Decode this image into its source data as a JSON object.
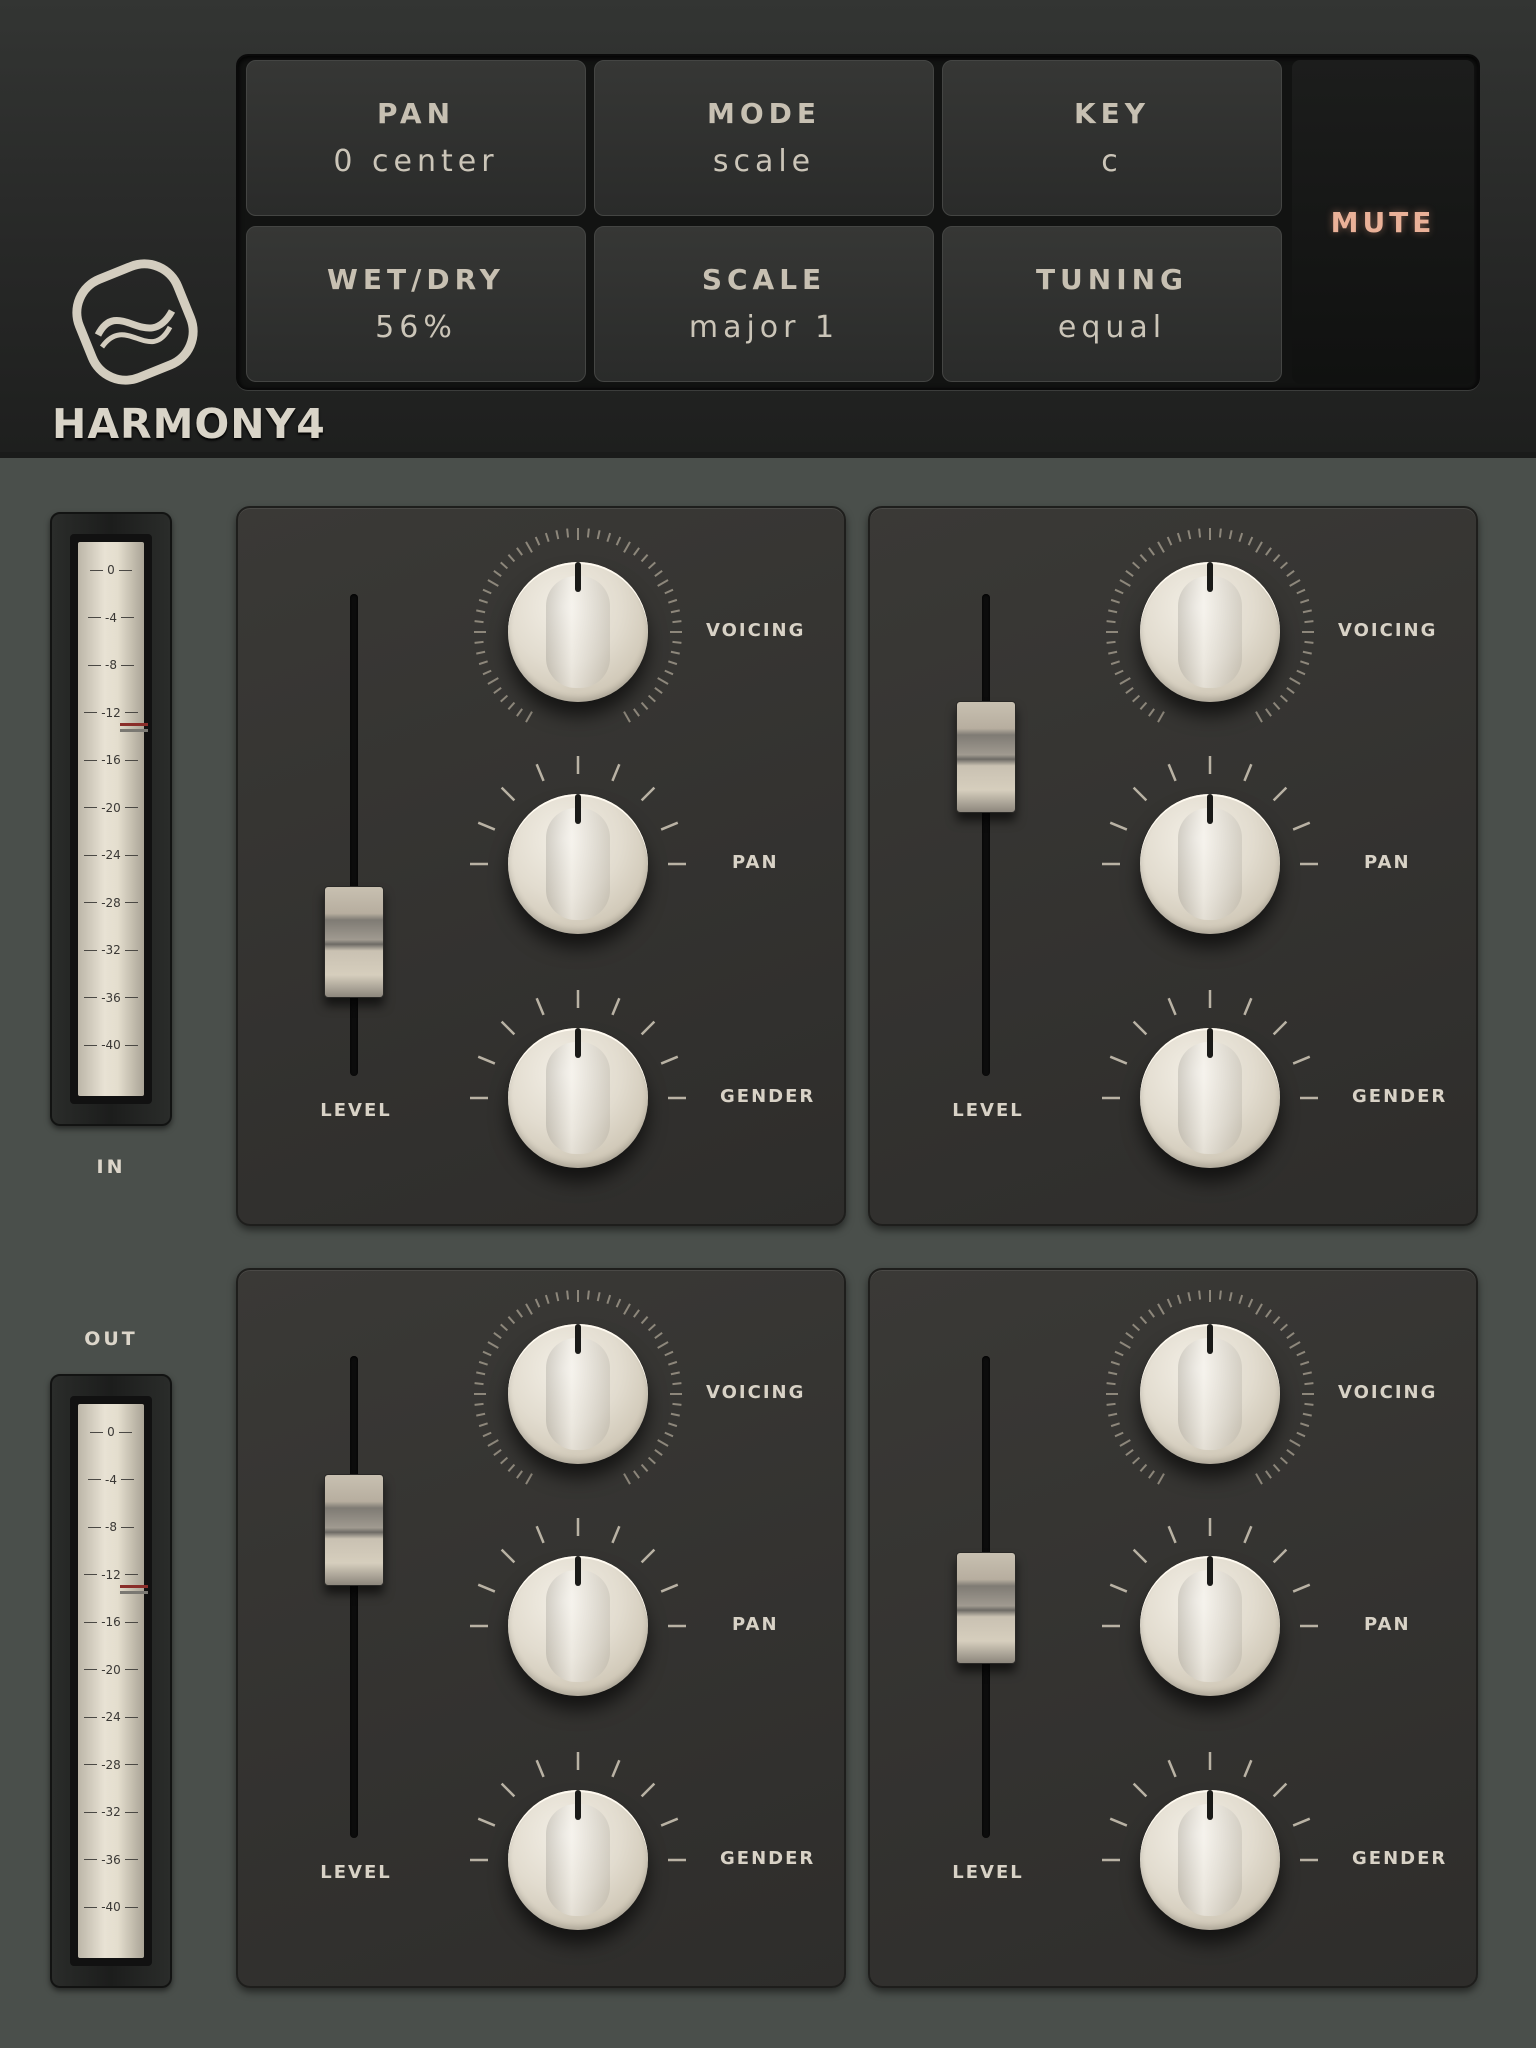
{
  "app": {
    "brand": "HARMONY4",
    "colors": {
      "accent_mute": "#eab198",
      "knob": "#e2dccf",
      "panel": "#2e2d2b"
    }
  },
  "display": {
    "cells": [
      {
        "label": "PAN",
        "value": "0 center"
      },
      {
        "label": "MODE",
        "value": "scale"
      },
      {
        "label": "KEY",
        "value": "c"
      },
      {
        "label": "WET/DRY",
        "value": "56%"
      },
      {
        "label": "SCALE",
        "value": "major 1"
      },
      {
        "label": "TUNING",
        "value": "equal"
      }
    ],
    "mute_label": "MUTE"
  },
  "meters": {
    "in_label": "IN",
    "out_label": "OUT",
    "scale": [
      "0",
      "-4",
      "-8",
      "-12",
      "-16",
      "-20",
      "-24",
      "-28",
      "-32",
      "-36",
      "-40"
    ]
  },
  "voices": [
    {
      "level_label": "LEVEL",
      "voicing_label": "VOICING",
      "pan_label": "PAN",
      "gender_label": "GENDER",
      "level": 0.21
    },
    {
      "level_label": "LEVEL",
      "voicing_label": "VOICING",
      "pan_label": "PAN",
      "gender_label": "GENDER",
      "level": 0.71
    },
    {
      "level_label": "LEVEL",
      "voicing_label": "VOICING",
      "pan_label": "PAN",
      "gender_label": "GENDER",
      "level": 0.68
    },
    {
      "level_label": "LEVEL",
      "voicing_label": "VOICING",
      "pan_label": "PAN",
      "gender_label": "GENDER",
      "level": 0.47
    }
  ]
}
